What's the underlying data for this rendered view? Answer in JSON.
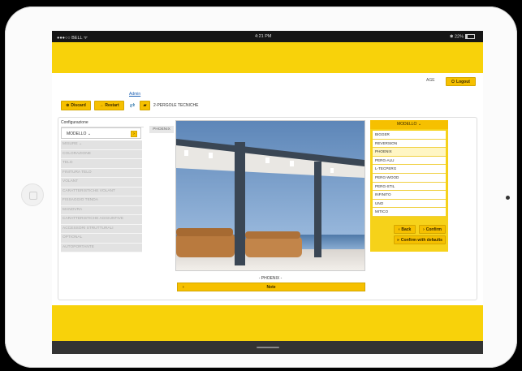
{
  "status_bar": {
    "carrier": "●●●○○ BELL ᯤ",
    "time": "4:21 PM",
    "battery": "✱ 22%"
  },
  "header": {
    "age_label": "AGE",
    "logout_label": "Logout"
  },
  "toolbar": {
    "admin_link": "Admin",
    "discard_label": "Discard",
    "restart_label": "Restart",
    "brand_title": "2-PERGOLE TECNICHE"
  },
  "left_panel": {
    "config_label": "Configurazione",
    "model_selector": "MODELLO ⌄",
    "menu_items": [
      "MISURE ⌄",
      "COLORAZIONE",
      "TELO",
      "FINITURA TELO",
      "VOLANT",
      "CARATTERISTICHE VOLANT",
      "FISSAGGIO TENDA",
      "MANOVRA",
      "CARATTERISTICHE AGGIUNTIVE",
      "ACCESSORI STRUTTURALI",
      "OPTIONAL",
      "AUTOPORTANTE"
    ]
  },
  "center": {
    "tab_label": "PHOENIX",
    "caption": "- PHOENIX -",
    "note_label": "Note"
  },
  "model_panel": {
    "header": "MODELLO ⌄",
    "options": [
      "BIGGER",
      "REVERSION",
      "PHOENIX",
      "PERG-ALU",
      "L-TECPERG",
      "PERG-WOOD",
      "PERG-STIL",
      "INFINITO",
      "UNO",
      "MITICO"
    ],
    "selected": "PHOENIX",
    "back_label": "Back",
    "confirm_label": "Confirm",
    "confirm_defaults_label": "Confirm with defaults"
  },
  "colors": {
    "accent_yellow": "#f8d20a",
    "button_yellow": "#f6c000"
  },
  "battery_level": 0.22
}
